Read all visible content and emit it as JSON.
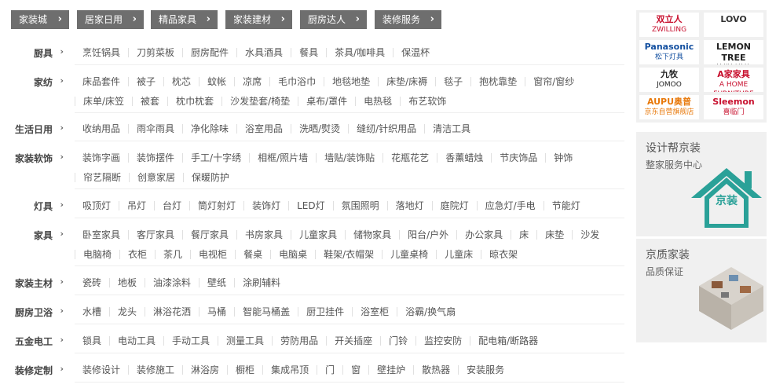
{
  "channels": [
    {
      "label": "家装城"
    },
    {
      "label": "居家日用"
    },
    {
      "label": "精品家具"
    },
    {
      "label": "家装建材"
    },
    {
      "label": "厨房达人"
    },
    {
      "label": "装修服务"
    }
  ],
  "chevron_icon": "›",
  "categories": [
    {
      "name": "厨具",
      "items": [
        "烹饪锅具",
        "刀剪菜板",
        "厨房配件",
        "水具酒具",
        "餐具",
        "茶具/咖啡具",
        "保温杯"
      ]
    },
    {
      "name": "家纺",
      "items": [
        "床品套件",
        "被子",
        "枕芯",
        "蚊帐",
        "凉席",
        "毛巾浴巾",
        "地毯地垫",
        "床垫/床褥",
        "毯子",
        "抱枕靠垫",
        "窗帘/窗纱",
        "床单/床笠",
        "被套",
        "枕巾枕套",
        "沙发垫套/椅垫",
        "桌布/罩件",
        "电热毯",
        "布艺软饰"
      ]
    },
    {
      "name": "生活日用",
      "items": [
        "收纳用品",
        "雨伞雨具",
        "净化除味",
        "浴室用品",
        "洗晒/熨烫",
        "缝纫/针织用品",
        "清洁工具"
      ]
    },
    {
      "name": "家装软饰",
      "items": [
        "装饰字画",
        "装饰摆件",
        "手工/十字绣",
        "相框/照片墙",
        "墙贴/装饰贴",
        "花瓶花艺",
        "香薰蜡烛",
        "节庆饰品",
        "钟饰",
        "帘艺隔断",
        "创意家居",
        "保暖防护"
      ]
    },
    {
      "name": "灯具",
      "items": [
        "吸顶灯",
        "吊灯",
        "台灯",
        "筒灯射灯",
        "装饰灯",
        "LED灯",
        "氛围照明",
        "落地灯",
        "庭院灯",
        "应急灯/手电",
        "节能灯"
      ]
    },
    {
      "name": "家具",
      "items": [
        "卧室家具",
        "客厅家具",
        "餐厅家具",
        "书房家具",
        "儿童家具",
        "储物家具",
        "阳台/户外",
        "办公家具",
        "床",
        "床垫",
        "沙发",
        "电脑椅",
        "衣柜",
        "茶几",
        "电视柜",
        "餐桌",
        "电脑桌",
        "鞋架/衣帽架",
        "儿童桌椅",
        "儿童床",
        "晾衣架"
      ]
    },
    {
      "name": "家装主材",
      "items": [
        "瓷砖",
        "地板",
        "油漆涂料",
        "壁纸",
        "涂刷辅料"
      ]
    },
    {
      "name": "厨房卫浴",
      "items": [
        "水槽",
        "龙头",
        "淋浴花洒",
        "马桶",
        "智能马桶盖",
        "厨卫挂件",
        "浴室柜",
        "浴霸/换气扇"
      ]
    },
    {
      "name": "五金电工",
      "items": [
        "锁具",
        "电动工具",
        "手动工具",
        "测量工具",
        "劳防用品",
        "开关插座",
        "门铃",
        "监控安防",
        "配电箱/断路器"
      ]
    },
    {
      "name": "装修定制",
      "items": [
        "装修设计",
        "装修施工",
        "淋浴房",
        "橱柜",
        "集成吊顶",
        "门",
        "窗",
        "壁挂炉",
        "散热器",
        "安装服务"
      ]
    }
  ],
  "brands": [
    {
      "line1": "双立人",
      "line2": "ZWILLING",
      "color": "#c8102e"
    },
    {
      "line1": "LOVO",
      "line2": "",
      "color": "#333333"
    },
    {
      "line1": "Panasonic",
      "line2": "松下灯具",
      "color": "#1450a0"
    },
    {
      "line1": "LEMON TREE",
      "line2": "柠檬树装饰",
      "color": "#222222"
    },
    {
      "line1": "九牧",
      "line2": "JOMOO",
      "color": "#222222"
    },
    {
      "line1": "A家家具",
      "line2": "A HOME FURNITURE",
      "color": "#c8102e"
    },
    {
      "line1": "AUPU奥普",
      "line2": "京东自营旗舰店",
      "color": "#e8790b"
    },
    {
      "line1": "Sleemon",
      "line2": "喜临门",
      "color": "#c8102e"
    }
  ],
  "promos": [
    {
      "title": "设计帮京装",
      "subtitle": "整家服务中心",
      "icon": "house-icon",
      "icon_text": "京装",
      "accent": "#2aa198"
    },
    {
      "title": "京质家装",
      "subtitle": "品质保证",
      "icon": "floorplan-icon"
    }
  ]
}
